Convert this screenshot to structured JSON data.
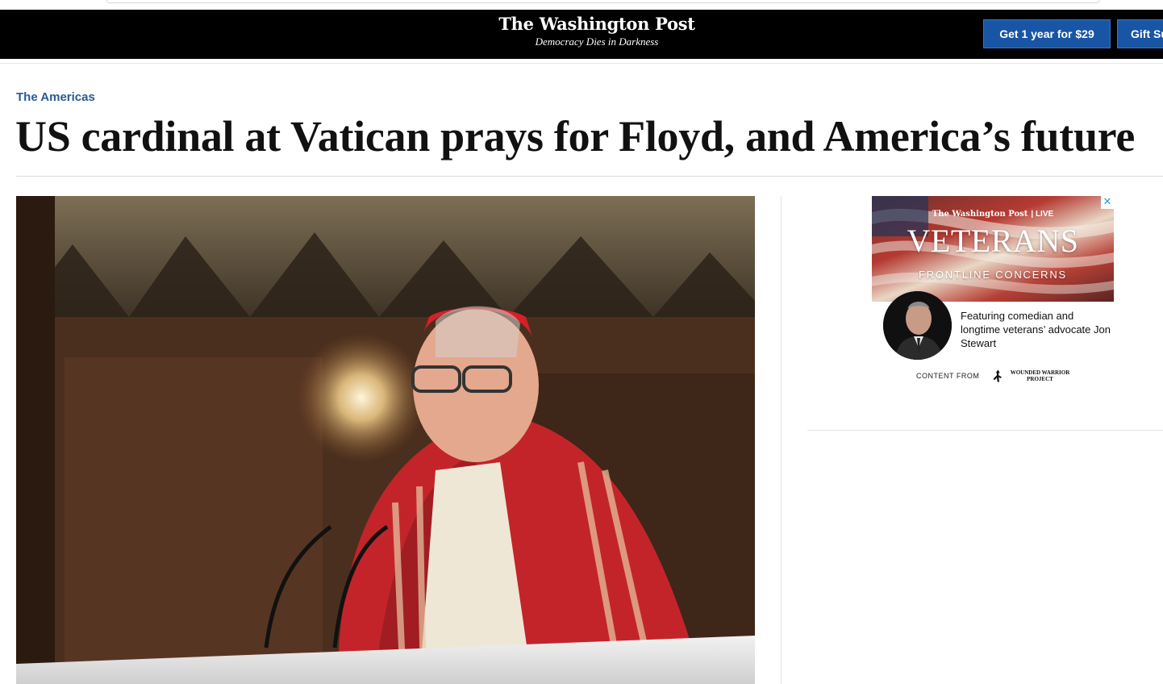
{
  "header": {
    "logo": "The Washington Post",
    "tagline": "Democracy Dies in Darkness",
    "subscribe_label": "Get 1 year for $29",
    "gift_label": "Gift Su",
    "background": "#000000",
    "button_color": "#1955a5"
  },
  "article": {
    "kicker": "The Americas",
    "headline": "US cardinal at Vatican prays for Floyd, and America’s future",
    "kicker_color": "#2a5a8e",
    "lead_image": "cardinal-at-altar-photo"
  },
  "ad": {
    "close_symbol": "✕",
    "brand": "The Washington Post",
    "brand_suffix": "| LIVE",
    "title": "VETERANS",
    "subtitle": "FRONTLINE CONCERNS",
    "copy": "Featuring comedian and longtime veterans’ advocate Jon Stewart",
    "content_from": "CONTENT FROM",
    "sponsor": "WOUNDED WARRIOR PROJECT"
  }
}
